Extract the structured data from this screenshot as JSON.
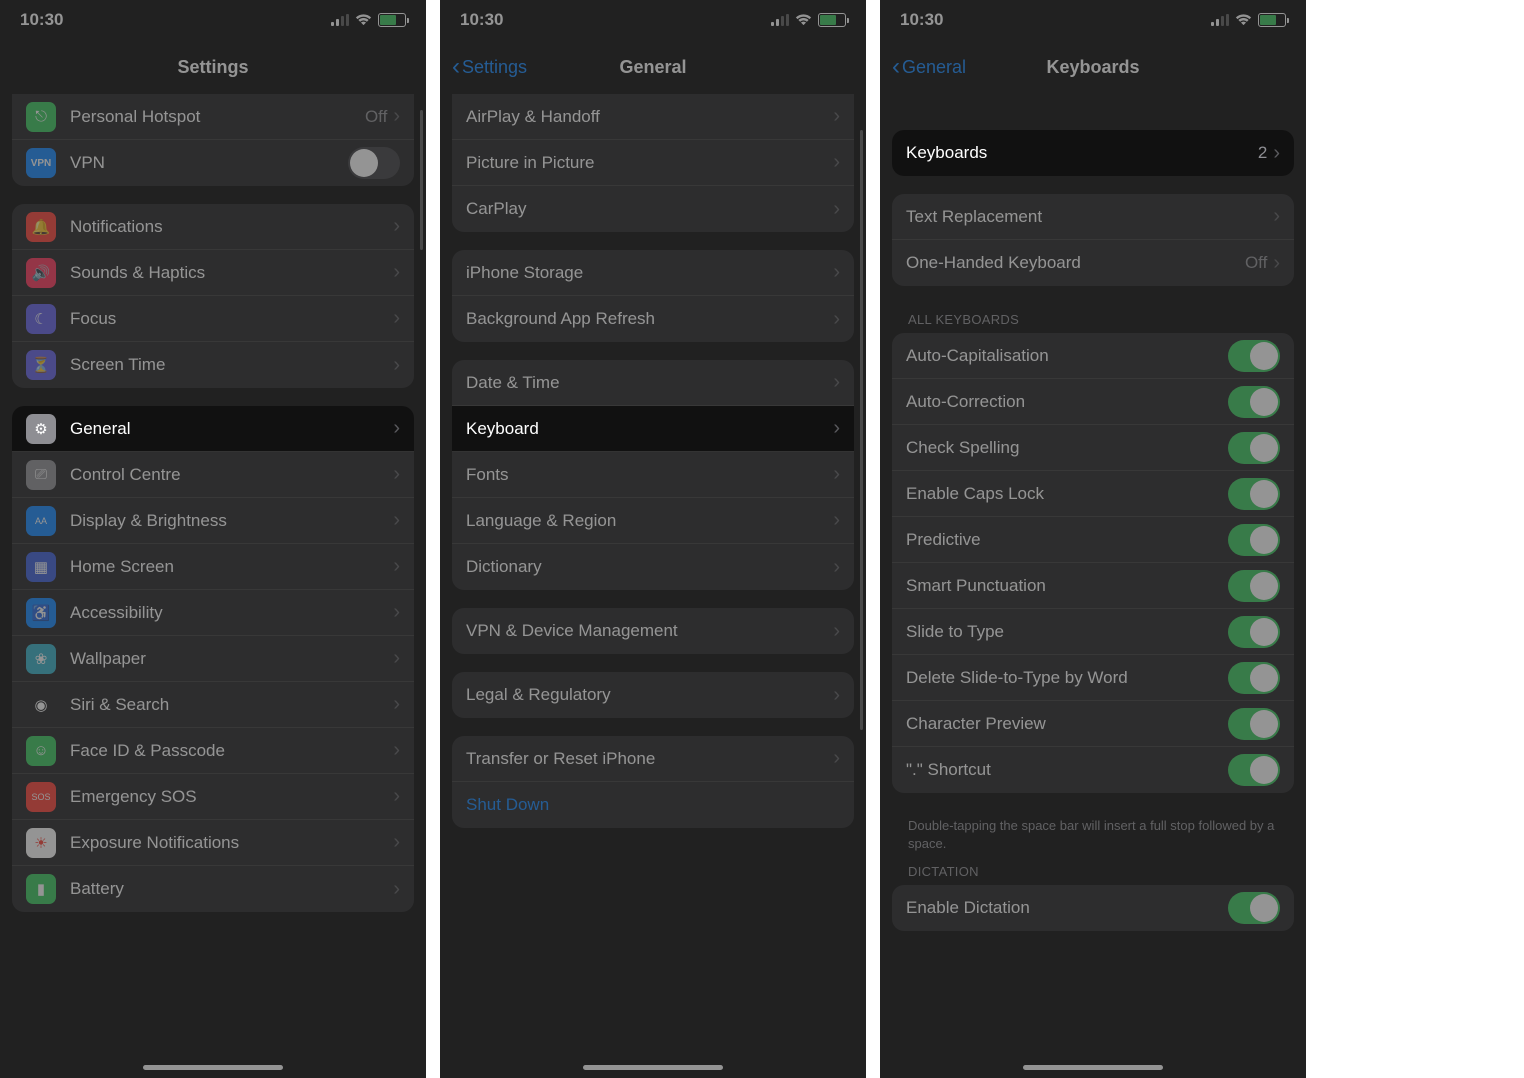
{
  "time": "10:30",
  "battery_pct": 65,
  "screen1": {
    "title": "Settings",
    "items_top": [
      {
        "label": "Personal Hotspot",
        "value": "Off",
        "icon": "hotspot-icon",
        "color": "#34c759"
      },
      {
        "label": "VPN",
        "toggle": false,
        "icon": "vpn-icon",
        "color": "#0a84ff"
      }
    ],
    "group_notif": [
      {
        "label": "Notifications",
        "icon": "bell-icon",
        "color": "#ff3b30"
      },
      {
        "label": "Sounds & Haptics",
        "icon": "speaker-icon",
        "color": "#ff2d55"
      },
      {
        "label": "Focus",
        "icon": "moon-icon",
        "color": "#5e5ce6"
      },
      {
        "label": "Screen Time",
        "icon": "hourglass-icon",
        "color": "#5e5ce6"
      }
    ],
    "group_general": [
      {
        "label": "General",
        "icon": "gear-icon",
        "color": "#8e8e93",
        "highlight": true
      },
      {
        "label": "Control Centre",
        "icon": "switches-icon",
        "color": "#8e8e93"
      },
      {
        "label": "Display & Brightness",
        "icon": "aa-icon",
        "color": "#0a84ff"
      },
      {
        "label": "Home Screen",
        "icon": "grid-icon",
        "color": "#3759d9"
      },
      {
        "label": "Accessibility",
        "icon": "accessibility-icon",
        "color": "#0a84ff"
      },
      {
        "label": "Wallpaper",
        "icon": "wallpaper-icon",
        "color": "#30b0c7"
      },
      {
        "label": "Siri & Search",
        "icon": "siri-icon",
        "color": "#1c1c1e"
      },
      {
        "label": "Face ID & Passcode",
        "icon": "faceid-icon",
        "color": "#34c759"
      },
      {
        "label": "Emergency SOS",
        "icon": "sos-icon",
        "color": "#ff3b30"
      },
      {
        "label": "Exposure Notifications",
        "icon": "exposure-icon",
        "color": "#ffffff"
      },
      {
        "label": "Battery",
        "icon": "battery-icon",
        "color": "#34c759"
      }
    ]
  },
  "screen2": {
    "back": "Settings",
    "title": "General",
    "group_top": [
      {
        "label": "AirPlay & Handoff"
      },
      {
        "label": "Picture in Picture"
      },
      {
        "label": "CarPlay"
      }
    ],
    "group_storage": [
      {
        "label": "iPhone Storage"
      },
      {
        "label": "Background App Refresh"
      }
    ],
    "group_kb": [
      {
        "label": "Date & Time"
      },
      {
        "label": "Keyboard",
        "highlight": true
      },
      {
        "label": "Fonts"
      },
      {
        "label": "Language & Region"
      },
      {
        "label": "Dictionary"
      }
    ],
    "group_vpn": [
      {
        "label": "VPN & Device Management"
      }
    ],
    "group_legal": [
      {
        "label": "Legal & Regulatory"
      }
    ],
    "group_reset": [
      {
        "label": "Transfer or Reset iPhone"
      },
      {
        "label": "Shut Down",
        "link": true
      }
    ]
  },
  "screen3": {
    "back": "General",
    "title": "Keyboards",
    "group_kb": {
      "label": "Keyboards",
      "value": "2",
      "highlight": true
    },
    "group_text": [
      {
        "label": "Text Replacement"
      },
      {
        "label": "One-Handed Keyboard",
        "value": "Off"
      }
    ],
    "all_header": "ALL KEYBOARDS",
    "all_toggles": [
      {
        "label": "Auto-Capitalisation",
        "on": true
      },
      {
        "label": "Auto-Correction",
        "on": true
      },
      {
        "label": "Check Spelling",
        "on": true
      },
      {
        "label": "Enable Caps Lock",
        "on": true
      },
      {
        "label": "Predictive",
        "on": true
      },
      {
        "label": "Smart Punctuation",
        "on": true
      },
      {
        "label": "Slide to Type",
        "on": true
      },
      {
        "label": "Delete Slide-to-Type by Word",
        "on": true
      },
      {
        "label": "Character Preview",
        "on": true
      },
      {
        "label": "\".\" Shortcut",
        "on": true
      }
    ],
    "all_footer": "Double-tapping the space bar will insert a full stop followed by a space.",
    "dictation_header": "DICTATION",
    "dictation": {
      "label": "Enable Dictation",
      "on": true
    }
  }
}
